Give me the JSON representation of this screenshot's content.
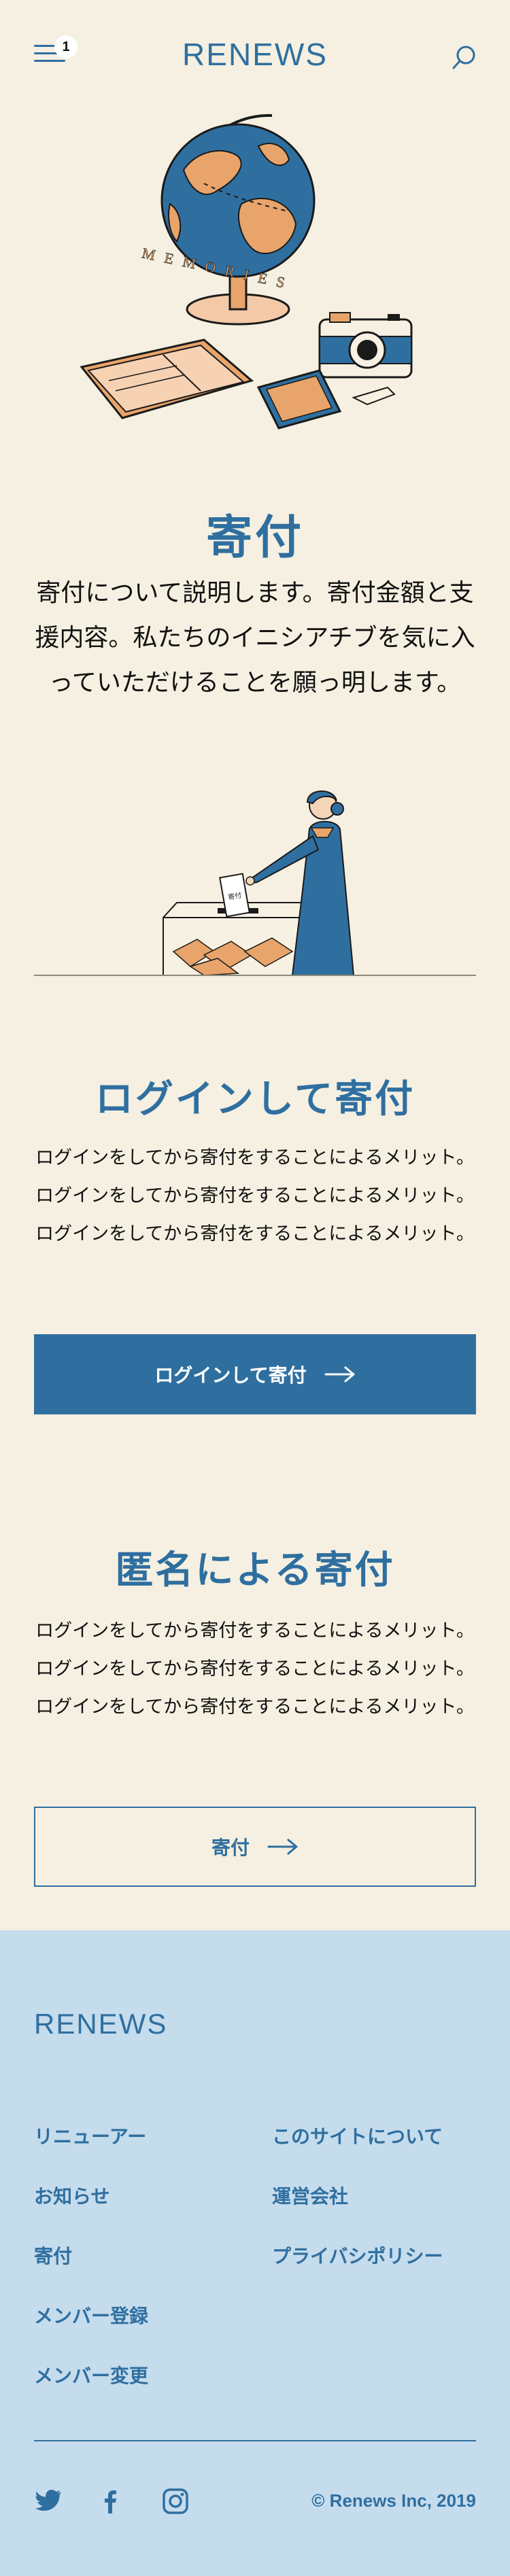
{
  "header": {
    "menu_badge": "1",
    "logo_text": "RENEWS"
  },
  "hero": {
    "illustration_text": "MEMORIES",
    "ballot_text": "寄付",
    "title": "寄付",
    "intro": "寄付について説明します。寄付金額と支援内容。私たちのイニシアチブを気に入っていただけることを願っ明します。"
  },
  "login_section": {
    "title": "ログインして寄付",
    "text": "ログインをしてから寄付をすることによるメリット。ログインをしてから寄付をすることによるメリット。ログインをしてから寄付をすることによるメリット。",
    "button_label": "ログインして寄付"
  },
  "anonymous_section": {
    "title": "匿名による寄付",
    "text": "ログインをしてから寄付をすることによるメリット。ログインをしてから寄付をすることによるメリット。ログインをしてから寄付をすることによるメリット。",
    "button_label": "寄付"
  },
  "footer": {
    "logo_text": "RENEWS",
    "links_left": [
      "リニューアー",
      "お知らせ",
      "寄付",
      "メンバー登録",
      "メンバー変更"
    ],
    "links_right": [
      "このサイトについて",
      "運営会社",
      "プライバシポリシー"
    ],
    "copyright": "© Renews Inc, 2019"
  },
  "colors": {
    "background": "#f5f0e1",
    "accent": "#2f6fa0",
    "footer_bg": "#c5dced",
    "illustration_orange": "#e8a46a"
  },
  "icons": [
    "menu-icon",
    "search-icon",
    "arrow-right-icon",
    "twitter-icon",
    "facebook-icon",
    "instagram-icon"
  ]
}
